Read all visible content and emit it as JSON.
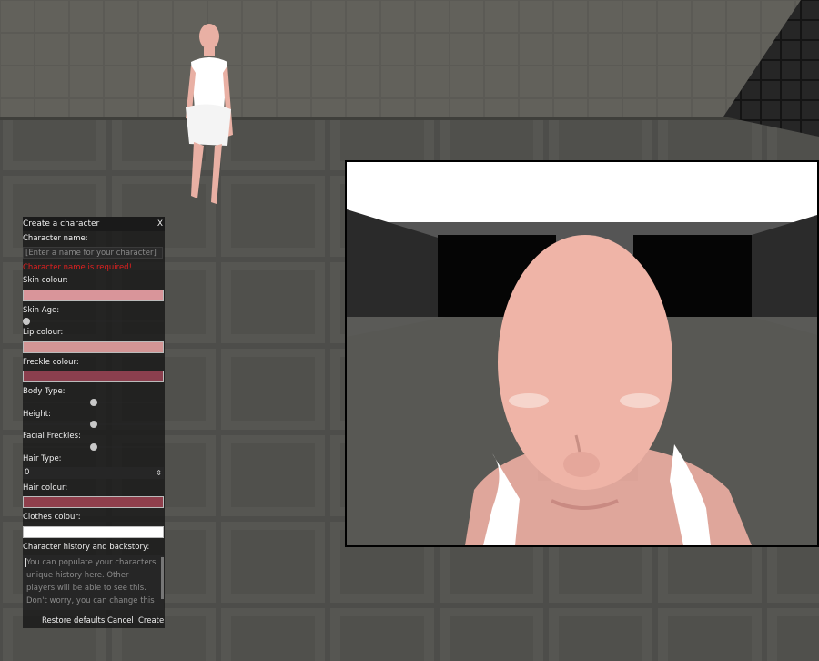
{
  "dialog": {
    "title": "Create a character",
    "close": "X",
    "name_label": "Character name:",
    "name_placeholder": "[Enter a name for your character]",
    "name_error": "Character name is required!",
    "skin_label": "Skin colour:",
    "skin_age_label": "Skin Age:",
    "lip_label": "Lip colour:",
    "freckle_label": "Freckle colour:",
    "body_type_label": "Body Type:",
    "height_label": "Height:",
    "facial_freckles_label": "Facial Freckles:",
    "hair_type_label": "Hair Type:",
    "hair_type_value": "0",
    "hair_colour_label": "Hair colour:",
    "clothes_label": "Clothes colour:",
    "history_label": "Character history and backstory:",
    "history_placeholder": "You can populate your characters unique history here. Other players will be able to see this. Don't worry, you can change this",
    "restore_label": "Restore defaults",
    "cancel_label": "Cancel",
    "create_label": "Create"
  },
  "colors": {
    "skin": "#d9959a",
    "lip": "#d39595",
    "freckle": "#8b3f4e",
    "hair": "#8f3f4c",
    "clothes": "#ffffff"
  },
  "sliders": {
    "skin_age": 0.0,
    "body_type": 0.5,
    "height": 0.5,
    "facial_freckles": 0.5
  }
}
